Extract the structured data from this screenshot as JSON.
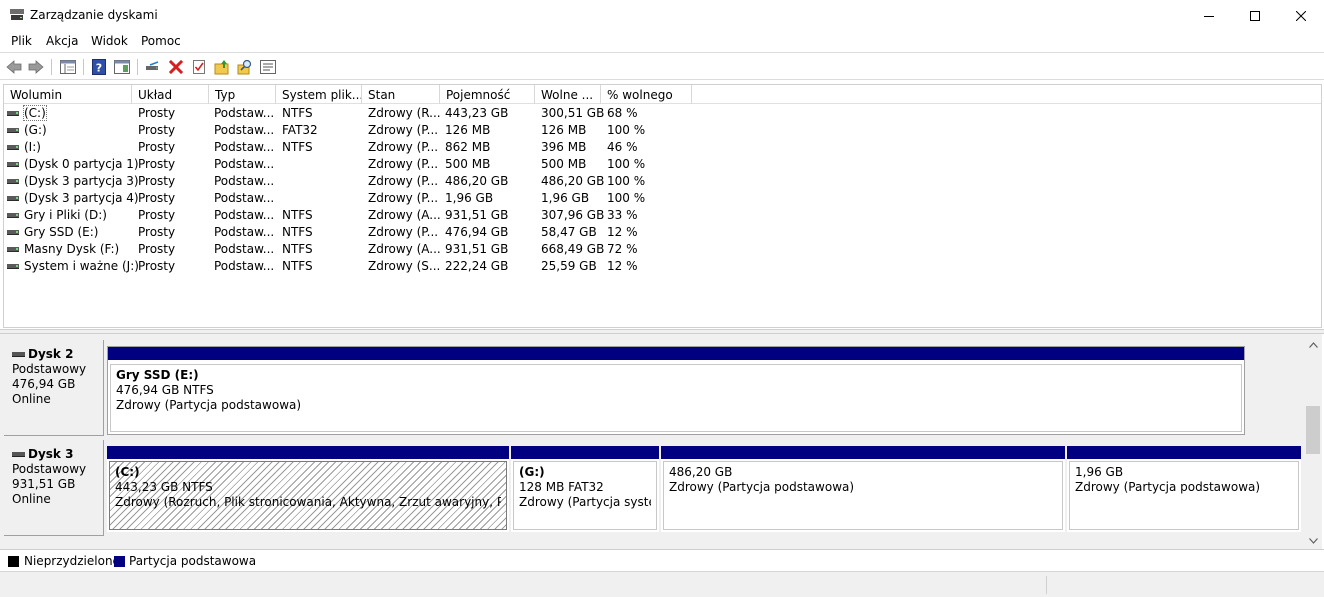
{
  "window": {
    "title": "Zarządzanie dyskami",
    "minimize_icon": "minimize-icon",
    "maximize_icon": "maximize-icon",
    "close_icon": "close-icon"
  },
  "menu": {
    "items": [
      "Plik",
      "Akcja",
      "Widok",
      "Pomoc"
    ]
  },
  "toolbar": {
    "icons": [
      "back-arrow-icon",
      "forward-arrow-icon",
      "console-tree-icon",
      "help-icon",
      "action-pane-icon",
      "connect-disk-icon",
      "delete-icon",
      "properties-check-icon",
      "up-folder-icon",
      "find-icon",
      "settings-list-icon"
    ]
  },
  "volumes": {
    "columns": [
      "Wolumin",
      "Układ",
      "Typ",
      "System plik...",
      "Stan",
      "Pojemność",
      "Wolne ...",
      "% wolnego"
    ],
    "rows": [
      [
        "(C:)",
        "Prosty",
        "Podstaw...",
        "NTFS",
        "Zdrowy (R...",
        "443,23 GB",
        "300,51 GB",
        "68 %"
      ],
      [
        "(G:)",
        "Prosty",
        "Podstaw...",
        "FAT32",
        "Zdrowy (P...",
        "126 MB",
        "126 MB",
        "100 %"
      ],
      [
        "(I:)",
        "Prosty",
        "Podstaw...",
        "NTFS",
        "Zdrowy (P...",
        "862 MB",
        "396 MB",
        "46 %"
      ],
      [
        "(Dysk 0 partycja 1)",
        "Prosty",
        "Podstaw...",
        "",
        "Zdrowy (P...",
        "500 MB",
        "500 MB",
        "100 %"
      ],
      [
        "(Dysk 3 partycja 3)",
        "Prosty",
        "Podstaw...",
        "",
        "Zdrowy (P...",
        "486,20 GB",
        "486,20 GB",
        "100 %"
      ],
      [
        "(Dysk 3 partycja 4)",
        "Prosty",
        "Podstaw...",
        "",
        "Zdrowy (P...",
        "1,96 GB",
        "1,96 GB",
        "100 %"
      ],
      [
        "Gry i Pliki (D:)",
        "Prosty",
        "Podstaw...",
        "NTFS",
        "Zdrowy (A...",
        "931,51 GB",
        "307,96 GB",
        "33 %"
      ],
      [
        "Gry SSD (E:)",
        "Prosty",
        "Podstaw...",
        "NTFS",
        "Zdrowy (P...",
        "476,94 GB",
        "58,47 GB",
        "12 %"
      ],
      [
        "Masny Dysk (F:)",
        "Prosty",
        "Podstaw...",
        "NTFS",
        "Zdrowy (A...",
        "931,51 GB",
        "668,49 GB",
        "72 %"
      ],
      [
        "System i ważne (J:)",
        "Prosty",
        "Podstaw...",
        "NTFS",
        "Zdrowy (S...",
        "222,24 GB",
        "25,59 GB",
        "12 %"
      ]
    ]
  },
  "disks": [
    {
      "name": "Dysk 2",
      "type": "Podstawowy",
      "size": "476,94 GB",
      "status": "Online",
      "partitions": [
        {
          "name": "Gry SSD  (E:)",
          "size": "476,94 GB NTFS",
          "status": "Zdrowy (Partycja podstawowa)"
        }
      ]
    },
    {
      "name": "Dysk 3",
      "type": "Podstawowy",
      "size": "931,51 GB",
      "status": "Online",
      "partitions": [
        {
          "name": "(C:)",
          "size": "443,23 GB NTFS",
          "status": "Zdrowy (Rozruch, Plik stronicowania, Aktywna, Zrzut awaryjny, Partycja podstawowa)"
        },
        {
          "name": "(G:)",
          "size": "128 MB FAT32",
          "status": "Zdrowy (Partycja systemowa)"
        },
        {
          "name": "",
          "size": "486,20 GB",
          "status": "Zdrowy (Partycja podstawowa)"
        },
        {
          "name": "",
          "size": "1,96 GB",
          "status": "Zdrowy (Partycja podstawowa)"
        }
      ]
    }
  ],
  "legend": {
    "unallocated": "Nieprzydzielone",
    "unallocated_color": "#000000",
    "primary": "Partycja podstawowa",
    "primary_color": "#000080"
  },
  "colors": {
    "partition_bar": "#000080",
    "pane_background": "#f0f0f0"
  }
}
